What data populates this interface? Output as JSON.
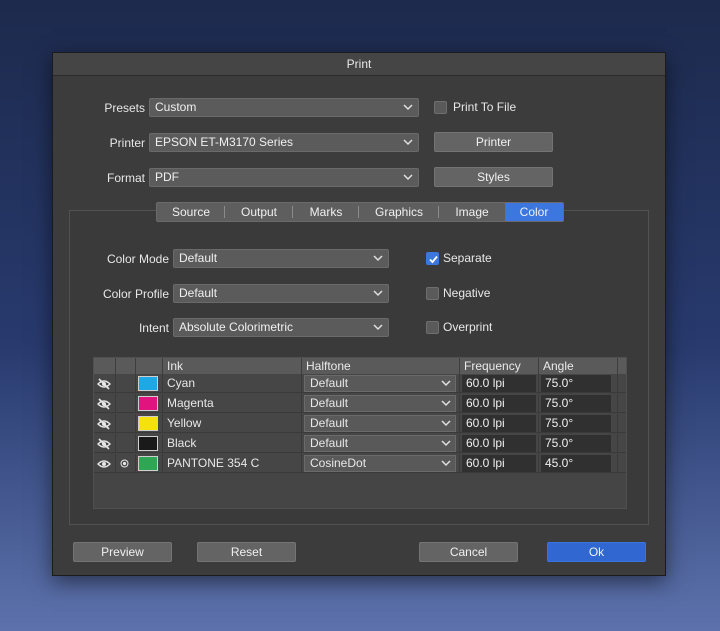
{
  "dialog": {
    "title": "Print"
  },
  "top": {
    "presets_label": "Presets",
    "presets_value": "Custom",
    "printer_label": "Printer",
    "printer_value": "EPSON ET-M3170 Series",
    "format_label": "Format",
    "format_value": "PDF",
    "print_to_file_label": "Print To File",
    "print_to_file_checked": false,
    "printer_button": "Printer",
    "styles_button": "Styles"
  },
  "tabs": [
    {
      "label": "Source",
      "active": false
    },
    {
      "label": "Output",
      "active": false
    },
    {
      "label": "Marks",
      "active": false
    },
    {
      "label": "Graphics",
      "active": false
    },
    {
      "label": "Image",
      "active": false
    },
    {
      "label": "Color",
      "active": true
    }
  ],
  "color": {
    "color_mode_label": "Color Mode",
    "color_mode_value": "Default",
    "color_profile_label": "Color Profile",
    "color_profile_value": "Default",
    "intent_label": "Intent",
    "intent_value": "Absolute Colorimetric",
    "separate_label": "Separate",
    "separate_checked": true,
    "negative_label": "Negative",
    "negative_checked": false,
    "overprint_label": "Overprint",
    "overprint_checked": false
  },
  "ink_table": {
    "headers": {
      "ink": "Ink",
      "halftone": "Halftone",
      "frequency": "Frequency",
      "angle": "Angle"
    },
    "rows": [
      {
        "visible_icon": "eye-slash-icon",
        "selected": false,
        "swatch": "#1ea8e6",
        "ink": "Cyan",
        "halftone": "Default",
        "frequency": "60.0 lpi",
        "angle": "75.0°"
      },
      {
        "visible_icon": "eye-slash-icon",
        "selected": false,
        "swatch": "#e0137f",
        "ink": "Magenta",
        "halftone": "Default",
        "frequency": "60.0 lpi",
        "angle": "75.0°"
      },
      {
        "visible_icon": "eye-slash-icon",
        "selected": false,
        "swatch": "#f5e10c",
        "ink": "Yellow",
        "halftone": "Default",
        "frequency": "60.0 lpi",
        "angle": "75.0°"
      },
      {
        "visible_icon": "eye-slash-icon",
        "selected": false,
        "swatch": "#1a1a1a",
        "ink": "Black",
        "halftone": "Default",
        "frequency": "60.0 lpi",
        "angle": "75.0°"
      },
      {
        "visible_icon": "eye-icon",
        "selected": true,
        "swatch": "#2ea654",
        "ink": "PANTONE 354 C",
        "halftone": "CosineDot",
        "frequency": "60.0 lpi",
        "angle": "45.0°"
      }
    ]
  },
  "footer": {
    "preview": "Preview",
    "reset": "Reset",
    "cancel": "Cancel",
    "ok": "Ok"
  }
}
